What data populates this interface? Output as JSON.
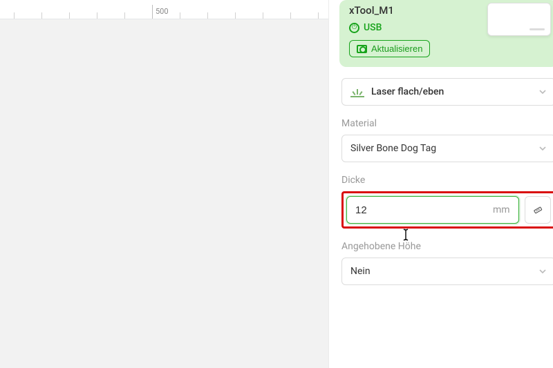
{
  "ruler": {
    "tick_major_label": "500"
  },
  "device": {
    "name": "xTool_M1",
    "connection": "USB",
    "update_label": "Aktualisieren"
  },
  "mode": {
    "label": "Laser flach/eben"
  },
  "material": {
    "heading": "Material",
    "value": "Silver Bone Dog Tag"
  },
  "thickness": {
    "heading": "Dicke",
    "value": "12",
    "unit": "mm"
  },
  "raised": {
    "heading": "Angehobene Höhe",
    "value": "Nein"
  }
}
